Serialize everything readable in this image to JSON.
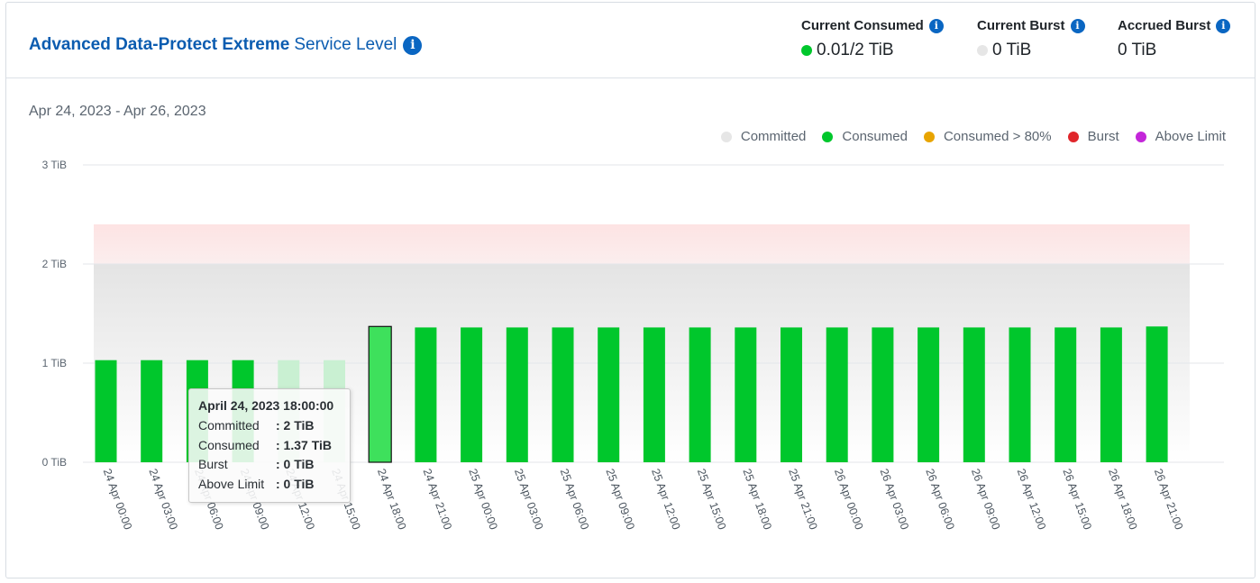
{
  "header": {
    "title_bold": "Advanced Data-Protect Extreme",
    "title_regular": "Service Level",
    "metrics": [
      {
        "label": "Current Consumed",
        "value": "0.01/2 TiB",
        "dot_color": "#00c72c"
      },
      {
        "label": "Current Burst",
        "value": "0 TiB",
        "dot_color": "#e6e6e6"
      },
      {
        "label": "Accrued Burst",
        "value": "0 TiB",
        "dot_color": ""
      }
    ]
  },
  "date_range": "Apr 24, 2023 - Apr 26, 2023",
  "legend": [
    {
      "label": "Committed",
      "color": "#e6e6e6"
    },
    {
      "label": "Consumed",
      "color": "#00c72c"
    },
    {
      "label": "Consumed > 80%",
      "color": "#e8a400"
    },
    {
      "label": "Burst",
      "color": "#e0262b"
    },
    {
      "label": "Above Limit",
      "color": "#c326d9"
    }
  ],
  "tooltip": {
    "title": "April 24, 2023 18:00:00",
    "rows": [
      {
        "key": "Committed",
        "value": ": 2 TiB"
      },
      {
        "key": "Consumed",
        "value": ": 1.37 TiB"
      },
      {
        "key": "Burst",
        "value": ": 0 TiB"
      },
      {
        "key": "Above Limit",
        "value": ": 0 TiB"
      }
    ]
  },
  "chart_data": {
    "type": "bar",
    "categories": [
      "24 Apr 00:00",
      "24 Apr 03:00",
      "24 Apr 06:00",
      "24 Apr 09:00",
      "24 Apr 12:00",
      "24 Apr 15:00",
      "24 Apr 18:00",
      "24 Apr 21:00",
      "25 Apr 00:00",
      "25 Apr 03:00",
      "25 Apr 06:00",
      "25 Apr 09:00",
      "25 Apr 12:00",
      "25 Apr 15:00",
      "25 Apr 18:00",
      "25 Apr 21:00",
      "26 Apr 00:00",
      "26 Apr 03:00",
      "26 Apr 06:00",
      "26 Apr 09:00",
      "26 Apr 12:00",
      "26 Apr 15:00",
      "26 Apr 18:00",
      "26 Apr 21:00"
    ],
    "series": [
      {
        "name": "Consumed",
        "values": [
          1.03,
          1.03,
          1.03,
          1.03,
          1.03,
          1.03,
          1.37,
          1.36,
          1.36,
          1.36,
          1.36,
          1.36,
          1.36,
          1.36,
          1.36,
          1.36,
          1.36,
          1.36,
          1.36,
          1.36,
          1.36,
          1.36,
          1.36,
          1.37
        ]
      }
    ],
    "committed": 2,
    "y_ticks": [
      "0 TiB",
      "1 TiB",
      "2 TiB",
      "3 TiB"
    ],
    "ylim": [
      0,
      3
    ],
    "highlighted_index": 6,
    "faded_indices": [
      4,
      5
    ],
    "colors": {
      "consumed": "#00c72c",
      "consumed_faded": "#c9f0d2",
      "highlighted": "#3ee05c",
      "committed_band": "#e6e6e6",
      "above_limit_band": "#fde3e3",
      "grid": "#e3e6ea",
      "tick_text": "#5b6570",
      "label_text": "#4a545e"
    }
  }
}
